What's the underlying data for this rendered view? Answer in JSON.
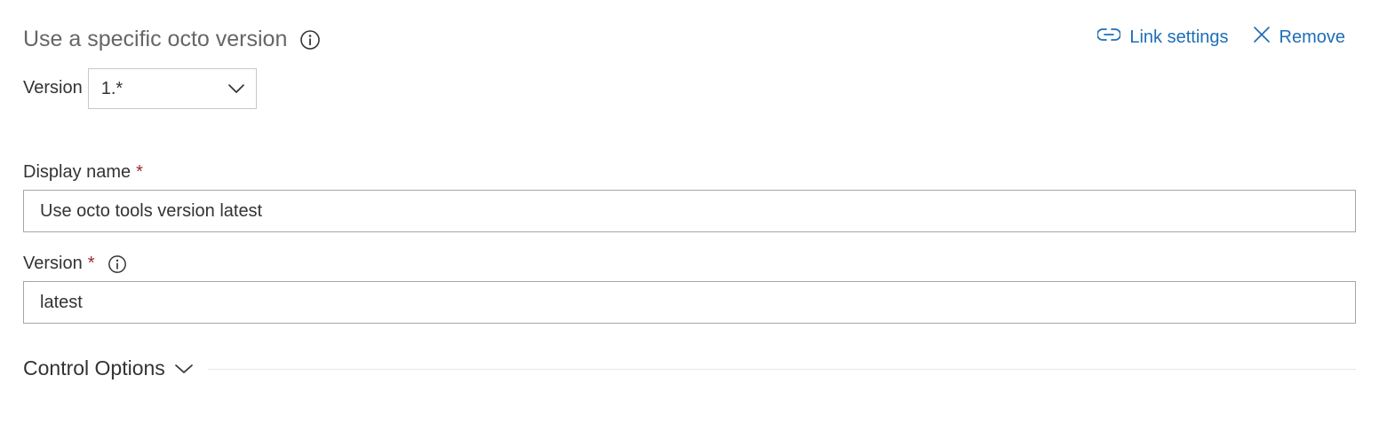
{
  "task": {
    "title": "Use a specific octo version",
    "title_icon": "info-icon"
  },
  "actions": {
    "link_settings": {
      "label": "Link settings",
      "icon": "link-icon"
    },
    "remove": {
      "label": "Remove",
      "icon": "close-icon"
    }
  },
  "task_version": {
    "label": "Version",
    "selected": "1.*",
    "icon": "chevron-down-icon"
  },
  "fields": {
    "display_name": {
      "label": "Display name",
      "required_mark": "*",
      "value": "Use octo tools version latest"
    },
    "version": {
      "label": "Version",
      "required_mark": "*",
      "info_icon": "info-icon",
      "value": "latest"
    }
  },
  "control_options": {
    "label": "Control Options",
    "icon": "chevron-down-icon"
  },
  "colors": {
    "accent": "#1e6eb5",
    "required": "#a4262c",
    "title_gray": "#666666"
  }
}
